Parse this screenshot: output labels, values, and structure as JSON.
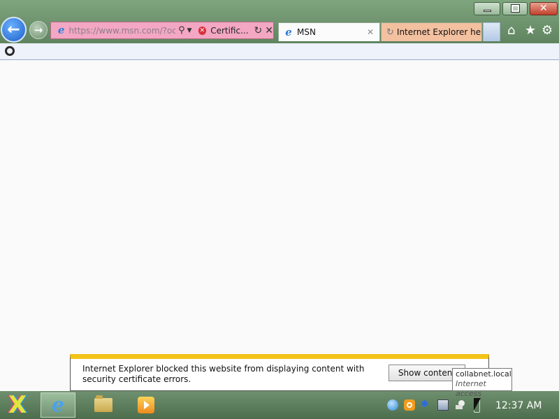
{
  "browser": {
    "address_bar": {
      "url": "https://www.msn.com/?ocid=",
      "cert_error_label": "Certific..."
    },
    "tabs": [
      {
        "label": "MSN",
        "active": true,
        "icon": "ie-icon"
      },
      {
        "label": "Internet Explorer hel...",
        "active": false,
        "icon": "loading-icon"
      }
    ]
  },
  "notification": {
    "message": "Internet Explorer blocked this website from displaying content with security certificate errors.",
    "button_label": "Show content"
  },
  "tooltip": {
    "title": "collabnet.local",
    "subtitle": "Internet access"
  },
  "taskbar": {
    "clock": "12:37 AM",
    "pinned": [
      "internet-explorer",
      "file-explorer",
      "media-player"
    ]
  },
  "colors": {
    "address_error": "#f3a7c3",
    "notification_accent": "#f2c318",
    "taskbar": "#5b7d5b"
  }
}
